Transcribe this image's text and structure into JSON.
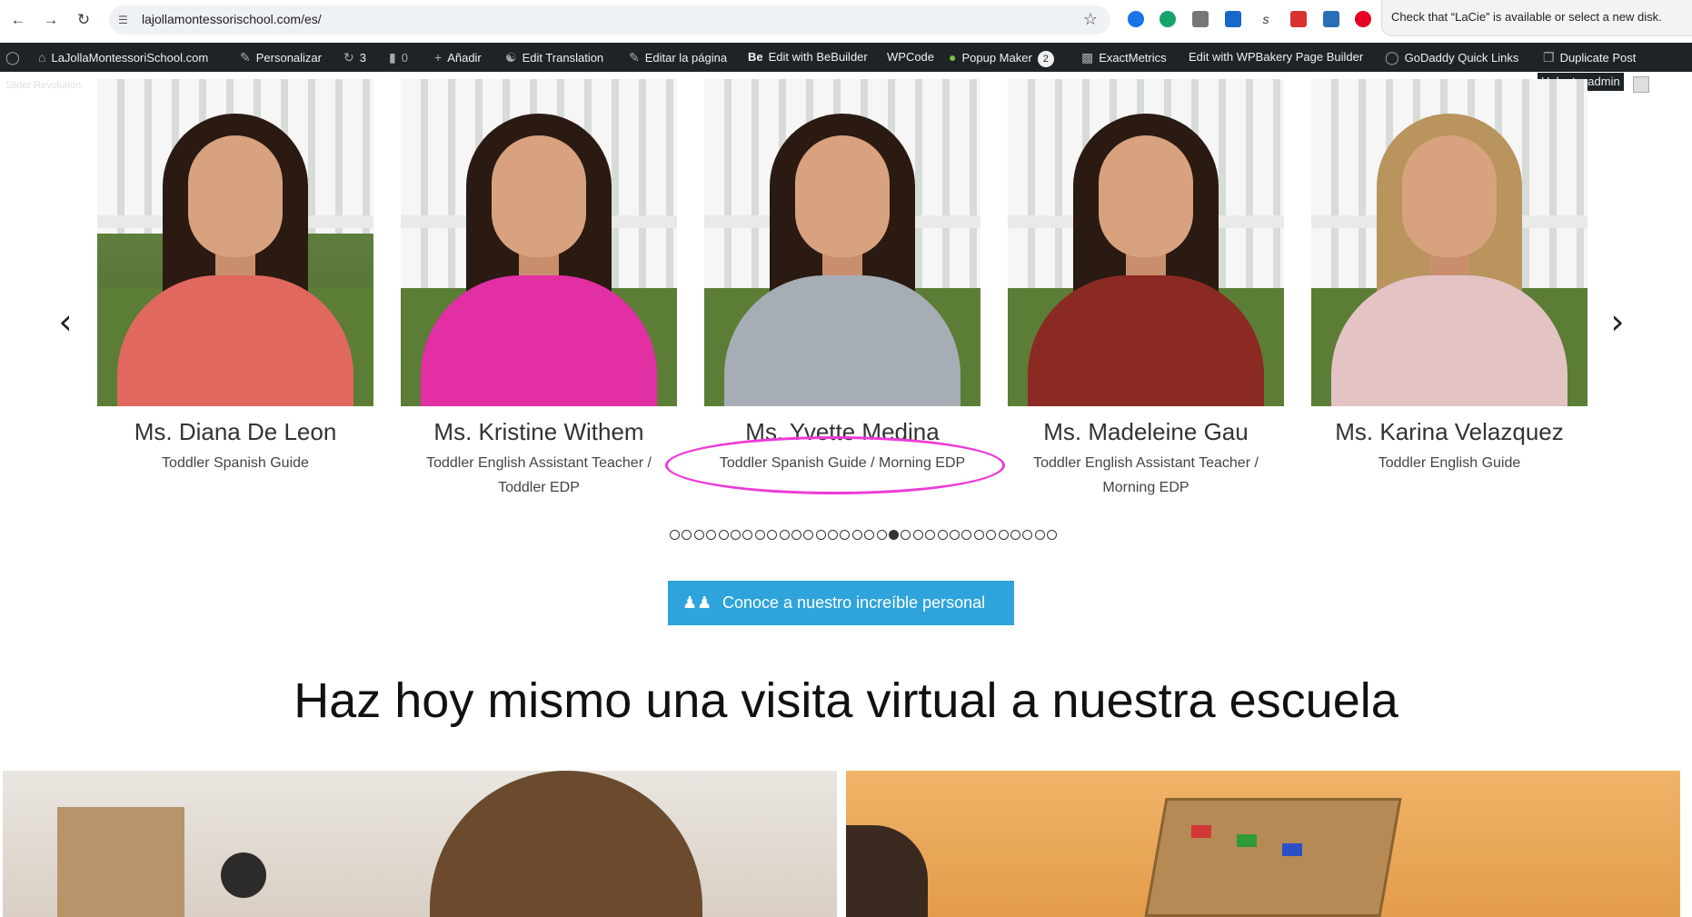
{
  "browser": {
    "url": "lajollamontessorischool.com/es/",
    "notification": "Check that “LaCie” is available or select a new disk."
  },
  "adminbar": {
    "site": "LaJollaMontessoriSchool.com",
    "customize": "Personalizar",
    "updates": "3",
    "comments": "0",
    "add_new": "Añadir",
    "edit_translation": "Edit Translation",
    "edit_page": "Editar la página",
    "bebuilder_prefix": "Be",
    "bebuilder": "Edit with BeBuilder",
    "wpcode": "WPCode",
    "popup_maker": "Popup Maker",
    "popup_count": "2",
    "exactmetrics": "ExactMetrics",
    "wpbakery": "Edit with WPBakery Page Builder",
    "godaddy": "GoDaddy Quick Links",
    "duplicate": "Duplicate Post",
    "greeting": "Hola, tecadmin"
  },
  "slider_label": "Slider Revolution",
  "team": [
    {
      "name": "Ms. Diana De Leon",
      "role": "Toddler Spanish Guide",
      "shirt": "#e0685f"
    },
    {
      "name": "Ms. Kristine Withem",
      "role": "Toddler English Assistant Teacher / Toddler EDP",
      "shirt": "#e22fa3"
    },
    {
      "name": "Ms. Yvette Medina",
      "role": "Toddler Spanish Guide / Morning EDP",
      "shirt": "#a6adb5"
    },
    {
      "name": "Ms. Madeleine Gau",
      "role": "Toddler English Assistant Teacher / Morning EDP",
      "shirt": "#8b2a22"
    },
    {
      "name": "Ms. Karina Velazquez",
      "role": "Toddler English Guide",
      "shirt": "#e3c3c4"
    }
  ],
  "pagination": {
    "total": 32,
    "active_index": 18
  },
  "cta": {
    "label": "Conoce a nuestro increíble personal"
  },
  "heading": "Haz hoy mismo una visita virtual a nuestra escuela",
  "colors": {
    "cta": "#2ea3dc",
    "highlight": "#ee3ad6",
    "adminbar": "#1d2327"
  }
}
